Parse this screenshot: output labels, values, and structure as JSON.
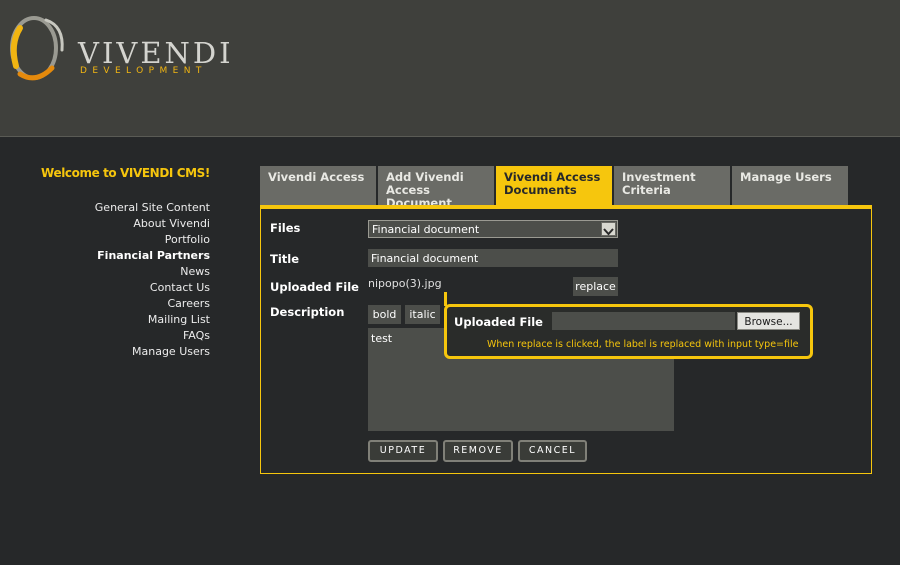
{
  "brand": {
    "name": "VIVENDI",
    "sub": "DEVELOPMENT",
    "accent": "#f6c60d"
  },
  "sidebar": {
    "welcome": "Welcome to VIVENDI CMS!",
    "items": [
      {
        "label": "General Site Content"
      },
      {
        "label": "About Vivendi"
      },
      {
        "label": "Portfolio"
      },
      {
        "label": "Financial Partners",
        "active": true
      },
      {
        "label": "News"
      },
      {
        "label": "Contact Us"
      },
      {
        "label": "Careers"
      },
      {
        "label": "Mailing List"
      },
      {
        "label": "FAQs"
      },
      {
        "label": "Manage Users"
      }
    ]
  },
  "tabs": [
    {
      "line1": "Vivendi Access",
      "line2": ""
    },
    {
      "line1": "Add Vivendi",
      "line2": "Access Document"
    },
    {
      "line1": "Vivendi Access",
      "line2": "Documents",
      "active": true
    },
    {
      "line1": "Investment",
      "line2": "Criteria"
    },
    {
      "line1": "Manage Users",
      "line2": ""
    }
  ],
  "form": {
    "files_label": "Files",
    "files_selected": "Financial document",
    "title_label": "Title",
    "title_value": "Financial document",
    "uploaded_label": "Uploaded File",
    "uploaded_filename": "nipopo(3).jpg",
    "replace_label": "replace",
    "description_label": "Description",
    "bold_label": "bold",
    "italic_label": "italic",
    "description_value": "test",
    "update_label": "UPDATE",
    "remove_label": "REMOVE",
    "cancel_label": "CANCEL"
  },
  "callout": {
    "label": "Uploaded File",
    "browse_label": "Browse...",
    "note": "When replace is clicked, the label is replaced with input type=file"
  }
}
